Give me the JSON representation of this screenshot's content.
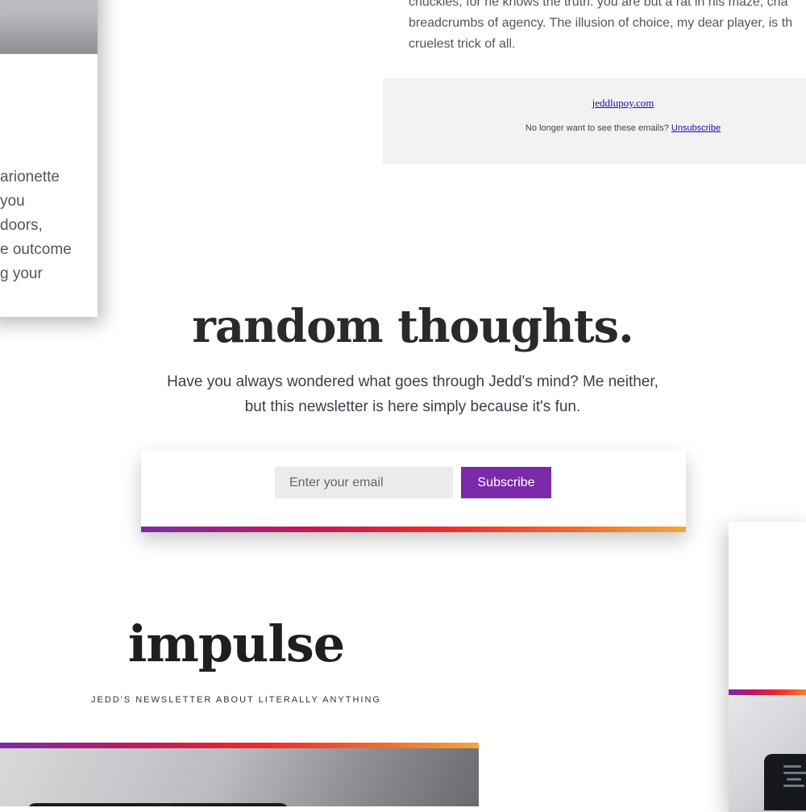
{
  "top_left_card": {
    "lines": [
      "arionette",
      "you",
      "doors,",
      "e outcome",
      "g your"
    ]
  },
  "top_right_card": {
    "body_lines": [
      "chuckles, for he knows the truth: you are but a rat in his maze, cha",
      "breadcrumbs of agency. The illusion of choice, my dear player, is th",
      "cruelest trick of all."
    ],
    "footer": {
      "site_link": "jeddlupoy.com",
      "unsubscribe_prompt": "No longer want to see these emails?",
      "unsubscribe_link": "Unsubscribe"
    }
  },
  "hero": {
    "title": "random thoughts.",
    "subtitle_lines": [
      "Have you always wondered what goes through Jedd's mind? Me neither,",
      "but this newsletter is here simply because it's fun."
    ]
  },
  "subscribe_form": {
    "email_placeholder": "Enter your email",
    "button_label": "Subscribe"
  },
  "brand": {
    "name": "impulse",
    "tagline": "JEDD'S NEWSLETTER ABOUT LITERALLY ANYTHING"
  },
  "colors": {
    "accent": "#7b2aa8",
    "gradient": [
      "#7b2aa8",
      "#c2185b",
      "#ee2a2a",
      "#f26b2a",
      "#f5a63a"
    ]
  }
}
